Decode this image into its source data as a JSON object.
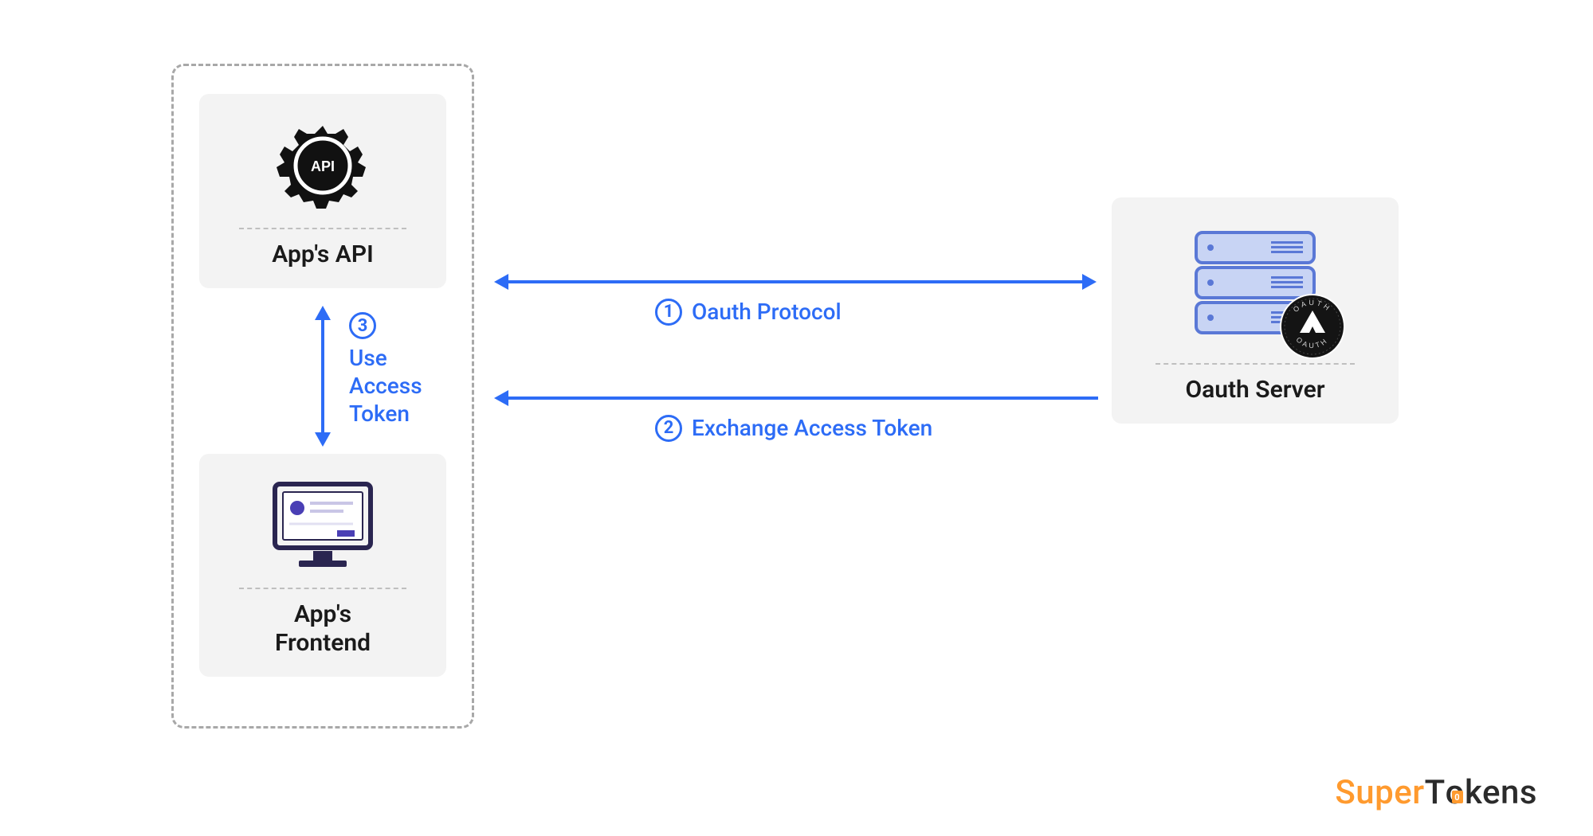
{
  "nodes": {
    "api": {
      "label": "App's API"
    },
    "frontend": {
      "label": "App's\nFrontend"
    },
    "server": {
      "label": "Oauth Server"
    }
  },
  "edges": {
    "step1": {
      "num": "1",
      "text": "Oauth Protocol"
    },
    "step2": {
      "num": "2",
      "text": "Exchange Access Token"
    },
    "step3": {
      "num": "3",
      "text": "Use\nAccess\nToken"
    }
  },
  "logo": {
    "part1": "Super",
    "part2": "T",
    "part3": "kens",
    "pad": "0"
  }
}
